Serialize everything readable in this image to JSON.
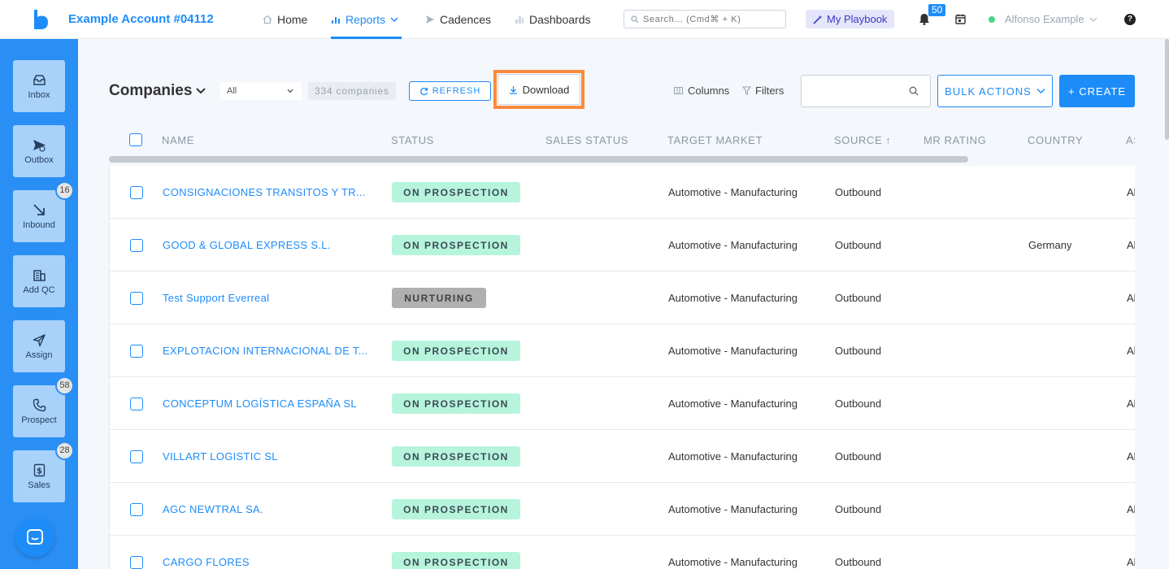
{
  "header": {
    "account": "Example Account #04112",
    "nav": [
      {
        "label": "Home",
        "icon": "home-icon"
      },
      {
        "label": "Reports",
        "icon": "reports-icon",
        "active": true
      },
      {
        "label": "Cadences",
        "icon": "cadences-icon"
      },
      {
        "label": "Dashboards",
        "icon": "dashboards-icon"
      }
    ],
    "search_placeholder": "Search... (Cmd⌘ + K)",
    "playbook": "My Playbook",
    "notifications": "50",
    "user": "Alfonso Example",
    "help": "?"
  },
  "sidebar": {
    "items": [
      {
        "label": "Inbox",
        "icon": "inbox-icon"
      },
      {
        "label": "Outbox",
        "icon": "outbox-icon"
      },
      {
        "label": "Inbound",
        "icon": "inbound-icon",
        "badge": "16"
      },
      {
        "label": "Add QC",
        "icon": "building-icon"
      },
      {
        "label": "Assign",
        "icon": "send-icon"
      },
      {
        "label": "Prospect",
        "icon": "phone-icon",
        "badge": "58"
      },
      {
        "label": "Sales",
        "icon": "dollar-icon",
        "badge": "28"
      }
    ]
  },
  "toolbar": {
    "title": "Companies",
    "filter_value": "All",
    "count": "334 companies",
    "refresh": "REFRESH",
    "download": "Download",
    "columns": "Columns",
    "filters": "Filters",
    "search_value": "",
    "bulk_actions": "BULK ACTIONS",
    "create": "+ CREATE"
  },
  "table": {
    "columns": [
      "NAME",
      "STATUS",
      "SALES STATUS",
      "TARGET MARKET",
      "SOURCE ↑",
      "MR RATING",
      "COUNTRY",
      "AS"
    ],
    "rows": [
      {
        "name": "CONSIGNACIONES TRANSITOS Y TR...",
        "status": "ON PROSPECTION",
        "sales_status": "",
        "target_market": "Automotive - Manufacturing",
        "source": "Outbound",
        "mr_rating": "",
        "country": "",
        "assigned": "Al"
      },
      {
        "name": "GOOD & GLOBAL EXPRESS S.L.",
        "status": "ON PROSPECTION",
        "sales_status": "",
        "target_market": "Automotive - Manufacturing",
        "source": "Outbound",
        "mr_rating": "",
        "country": "Germany",
        "assigned": "Al"
      },
      {
        "name": "Test Support Everreal",
        "status": "NURTURING",
        "sales_status": "",
        "target_market": "Automotive - Manufacturing",
        "source": "Outbound",
        "mr_rating": "",
        "country": "",
        "assigned": "Al"
      },
      {
        "name": "EXPLOTACION INTERNACIONAL DE T...",
        "status": "ON PROSPECTION",
        "sales_status": "",
        "target_market": "Automotive - Manufacturing",
        "source": "Outbound",
        "mr_rating": "",
        "country": "",
        "assigned": "Al"
      },
      {
        "name": "CONCEPTUM LOGÍSTICA ESPAÑA SL",
        "status": "ON PROSPECTION",
        "sales_status": "",
        "target_market": "Automotive - Manufacturing",
        "source": "Outbound",
        "mr_rating": "",
        "country": "",
        "assigned": "Al"
      },
      {
        "name": "VILLART LOGISTIC SL",
        "status": "ON PROSPECTION",
        "sales_status": "",
        "target_market": "Automotive - Manufacturing",
        "source": "Outbound",
        "mr_rating": "",
        "country": "",
        "assigned": "Al"
      },
      {
        "name": "AGC NEWTRAL SA.",
        "status": "ON PROSPECTION",
        "sales_status": "",
        "target_market": "Automotive - Manufacturing",
        "source": "Outbound",
        "mr_rating": "",
        "country": "",
        "assigned": "Al"
      },
      {
        "name": "CARGO FLORES",
        "status": "ON PROSPECTION",
        "sales_status": "",
        "target_market": "Automotive - Manufacturing",
        "source": "Outbound",
        "mr_rating": "",
        "country": "",
        "assigned": "Al"
      }
    ]
  },
  "colors": {
    "brand_blue": "#1d8cf8",
    "sidebar_blue": "#2a8ff5",
    "highlight_orange": "#fb8a3c",
    "prospection_green": "#b6f4dc",
    "nurturing_gray": "#b0b0b0"
  }
}
